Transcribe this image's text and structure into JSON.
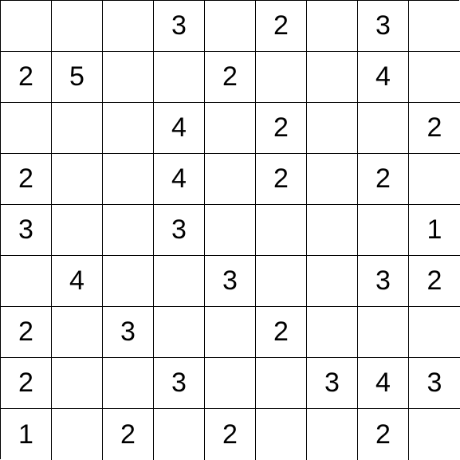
{
  "grid": {
    "rows": 9,
    "cols": 9,
    "cells": [
      [
        "",
        "",
        "",
        "3",
        "",
        "2",
        "",
        "3",
        ""
      ],
      [
        "2",
        "5",
        "",
        "",
        "2",
        "",
        "",
        "4",
        ""
      ],
      [
        "",
        "",
        "",
        "4",
        "",
        "2",
        "",
        "",
        "2"
      ],
      [
        "2",
        "",
        "",
        "4",
        "",
        "2",
        "",
        "2",
        ""
      ],
      [
        "3",
        "",
        "",
        "3",
        "",
        "",
        "",
        "",
        "1"
      ],
      [
        "",
        "4",
        "",
        "",
        "3",
        "",
        "",
        "3",
        "2"
      ],
      [
        "2",
        "",
        "3",
        "",
        "",
        "2",
        "",
        "",
        ""
      ],
      [
        "2",
        "",
        "",
        "3",
        "",
        "",
        "3",
        "4",
        "3"
      ],
      [
        "1",
        "",
        "2",
        "",
        "2",
        "",
        "",
        "2",
        ""
      ]
    ]
  }
}
